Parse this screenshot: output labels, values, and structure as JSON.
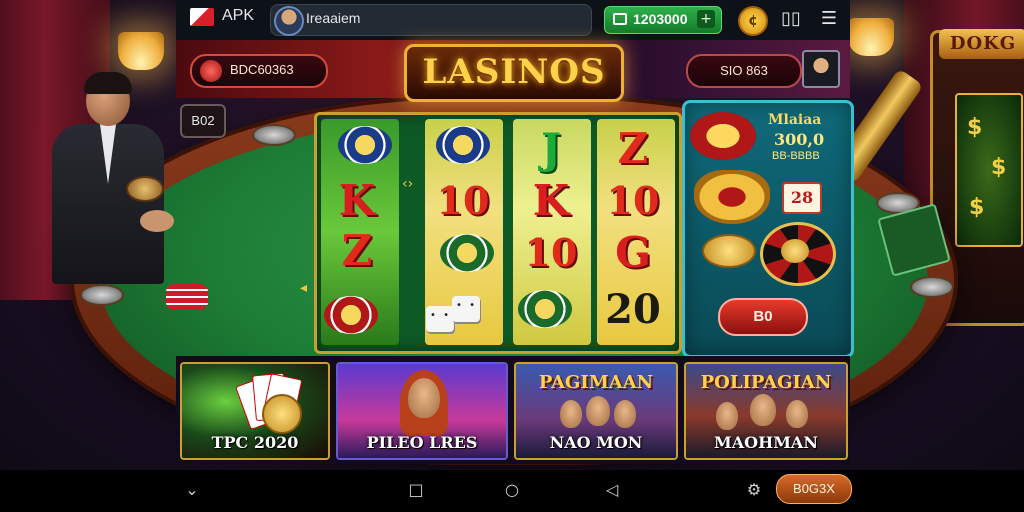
{
  "status_bar": {
    "app_label": "APK",
    "search_text": "Ireaaiem",
    "balance": "1203000",
    "balance_add": "+",
    "coin_icon": "coin-icon",
    "icons": [
      "phone-layout-icon",
      "menu-grid-icon"
    ]
  },
  "header": {
    "logo_text": "LASINOS",
    "jackpot_value": "BDC60363",
    "wallet_value": "SIO 863"
  },
  "side_badge": "B02",
  "reels": {
    "reel1": [
      "Z",
      "K",
      "Z"
    ],
    "reel2": [
      "10"
    ],
    "reel3": [
      "J",
      "K",
      "10"
    ],
    "reel4": [
      "Z",
      "10",
      "G",
      "20"
    ]
  },
  "info_panel": {
    "title": "Mlaiaa",
    "value": "300,0",
    "sub": "BB-BBBB",
    "badge": "28",
    "spin_label": "B0"
  },
  "game_cards": [
    {
      "title": "",
      "label": "TPC 2020"
    },
    {
      "title": "",
      "label": "PILEO LRES"
    },
    {
      "title": "PAGIMAAN",
      "label": "NAO MON"
    },
    {
      "title": "POLIPAGIAN",
      "label": "MAOHMAN"
    }
  ],
  "slot_machine_marquee": "DOKG",
  "nav": {
    "back": "back-chevron-icon",
    "home": "home-square-icon",
    "circle": "home-circle-icon",
    "recent": "back-triangle-icon",
    "settings": "settings-gear-icon",
    "pill_label": "B0G3X"
  },
  "colors": {
    "felt": "#1c7a34",
    "gold": "#f0b030",
    "accent_green": "#2fb04a",
    "panel": "#0f6a7a"
  }
}
